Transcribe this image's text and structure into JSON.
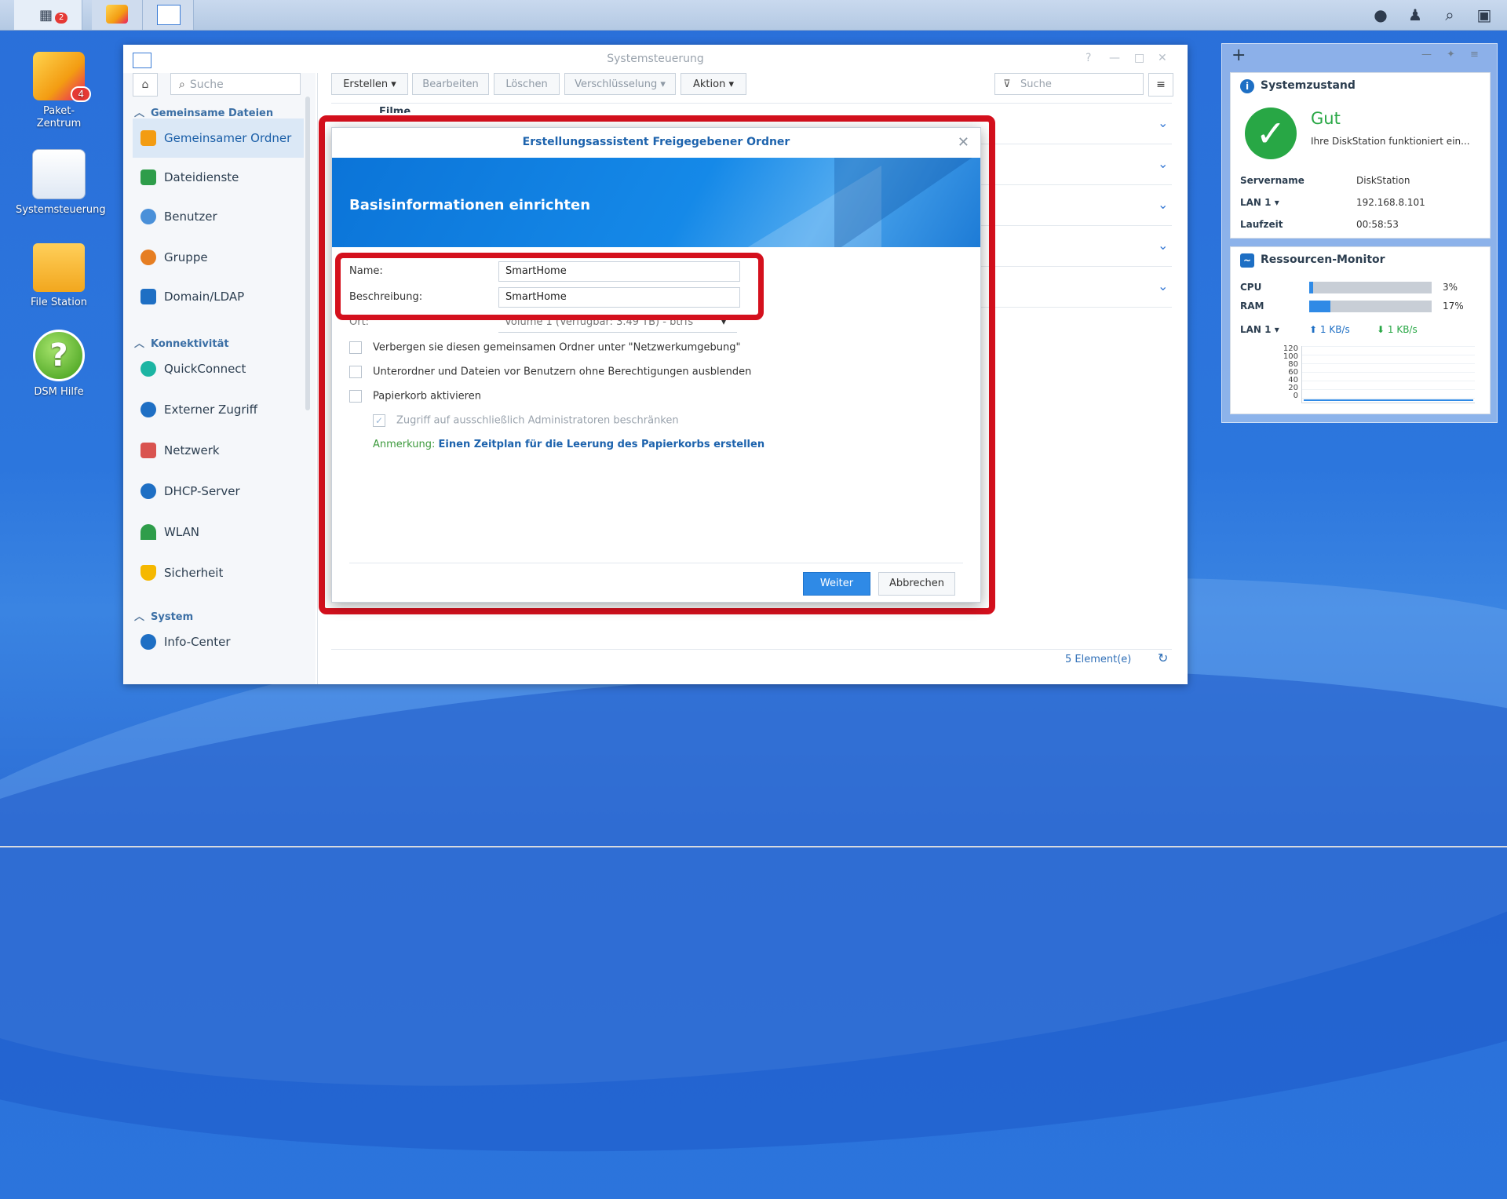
{
  "taskbar": {
    "main_menu_badge": "2",
    "right_icons": [
      "chat-icon",
      "user-icon",
      "search-icon",
      "widgets-icon"
    ]
  },
  "desktop": {
    "icons": [
      {
        "label": "Paket-\nZentrum",
        "badge": "4"
      },
      {
        "label": "Systemsteuerung"
      },
      {
        "label": "File Station"
      },
      {
        "label": "DSM Hilfe"
      }
    ]
  },
  "window": {
    "title": "Systemsteuerung",
    "sidebar": {
      "search_placeholder": "Suche",
      "groups": [
        {
          "label": "Gemeinsame Dateien"
        },
        {
          "label": "Konnektivität"
        },
        {
          "label": "System"
        }
      ],
      "items": [
        {
          "label": "Gemeinsamer Ordner",
          "active": true
        },
        {
          "label": "Dateidienste"
        },
        {
          "label": "Benutzer"
        },
        {
          "label": "Gruppe"
        },
        {
          "label": "Domain/LDAP"
        },
        {
          "label": "QuickConnect"
        },
        {
          "label": "Externer Zugriff"
        },
        {
          "label": "Netzwerk"
        },
        {
          "label": "DHCP-Server"
        },
        {
          "label": "WLAN"
        },
        {
          "label": "Sicherheit"
        },
        {
          "label": "Info-Center"
        }
      ]
    },
    "toolbar": {
      "create": "Erstellen",
      "edit": "Bearbeiten",
      "delete": "Löschen",
      "encryption": "Verschlüsselung",
      "action": "Aktion",
      "search_placeholder": "Suche"
    },
    "list_first_row": "Filme",
    "footer": {
      "count": "5 Element(e)"
    }
  },
  "dialog": {
    "title": "Erstellungsassistent Freigegebener Ordner",
    "heading": "Basisinformationen einrichten",
    "name_label": "Name:",
    "name_value": "SmartHome",
    "description_label": "Beschreibung:",
    "description_value": "SmartHome",
    "location_label": "Ort:",
    "location_value": "Volume 1 (Verfügbar: 3.49 TB) - btrfs",
    "checkboxes": [
      {
        "label": "Verbergen sie diesen gemeinsamen Ordner unter \"Netzwerkumgebung\"",
        "checked": false
      },
      {
        "label": "Unterordner und Dateien vor Benutzern ohne Berechtigungen ausblenden",
        "checked": false
      },
      {
        "label": "Papierkorb aktivieren",
        "checked": false
      },
      {
        "label": "Zugriff auf ausschließlich Administratoren beschränken",
        "checked": true,
        "disabled": true
      }
    ],
    "note_prefix": "Anmerkung:",
    "note_link": "Einen Zeitplan für die Leerung des Papierkorbs erstellen",
    "next_button": "Weiter",
    "cancel_button": "Abbrechen"
  },
  "widgets": {
    "health": {
      "title": "Systemzustand",
      "status": "Gut",
      "status_text": "Ihre DiskStation funktioniert ein...",
      "server_name_label": "Servername",
      "server_name": "DiskStation",
      "lan_label": "LAN 1",
      "lan_ip": "192.168.8.101",
      "uptime_label": "Laufzeit",
      "uptime": "00:58:53"
    },
    "resources": {
      "title": "Ressourcen-Monitor",
      "cpu_label": "CPU",
      "cpu_percent": 3,
      "cpu_text": "3%",
      "ram_label": "RAM",
      "ram_percent": 17,
      "ram_text": "17%",
      "lan_label": "LAN 1",
      "upload": "1 KB/s",
      "download": "1 KB/s",
      "y_ticks": [
        "120",
        "100",
        "80",
        "60",
        "40",
        "20",
        "0"
      ]
    }
  },
  "colors": {
    "accent": "#2f8ae6",
    "highlight": "#d4101d",
    "success": "#28a745"
  }
}
